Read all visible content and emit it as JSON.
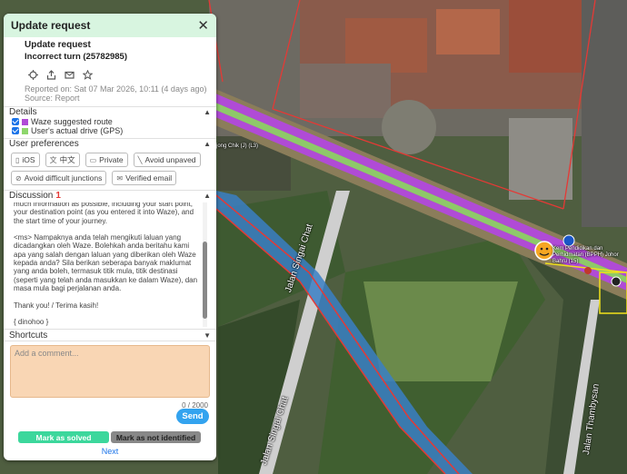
{
  "panel": {
    "title": "Update request",
    "close_glyph": "✕"
  },
  "request": {
    "title": "Update request",
    "type": "Incorrect turn (25782985)",
    "reported": "Reported on: Sat 07 Mar 2026, 10:11 (4 days ago)",
    "source": "Source: Report"
  },
  "details": {
    "header": "Details",
    "items": [
      {
        "label": "Waze suggested route",
        "color": "#b04bd6"
      },
      {
        "label": "User's actual drive (GPS)",
        "color": "#8ed66c"
      }
    ]
  },
  "preferences": {
    "header": "User preferences",
    "items": [
      {
        "label": "iOS",
        "icon": "phone-icon",
        "glyph": "▯"
      },
      {
        "label": "中文",
        "icon": "translate-icon",
        "glyph": "文"
      },
      {
        "label": "Private",
        "icon": "car-icon",
        "glyph": "▭"
      },
      {
        "label": "Avoid unpaved",
        "icon": "unpaved-icon",
        "glyph": "╲"
      },
      {
        "label": "Avoid difficult junctions",
        "icon": "junction-icon",
        "glyph": "⊘"
      },
      {
        "label": "Verified email",
        "icon": "email-icon",
        "glyph": "✉"
      }
    ]
  },
  "discussion": {
    "header": "Discussion",
    "count": "1",
    "text": "much information as possible, including your start point, your destination point (as you entered it into Waze), and the start time of your journey.\n\n<ms> Nampaknya anda telah mengikuti laluan yang dicadangkan oleh Waze. Bolehkah anda beritahu kami apa yang salah dengan laluan yang diberikan oleh Waze kepada anda? Sila berikan seberapa banyak maklumat yang anda boleh, termasuk titik mula, titik destinasi (seperti yang telah anda masukkan ke dalam Waze), dan masa mula bagi perjalanan anda.\n\nThank you! / Terima kasih!\n\n{ dinohoo }\nVolunteer, Map Editor Community\nSukarelawan, Komuniti Penyunting Peta\nWAZE MALAYSIA"
  },
  "shortcuts": {
    "header": "Shortcuts"
  },
  "comment": {
    "placeholder": "Add a comment...",
    "counter": "0 / 2000",
    "send_label": "Send"
  },
  "actions": {
    "solved_label": "Mark as solved",
    "not_identified_label": "Mark as not identified",
    "next_label": "Next"
  },
  "map": {
    "labels": {
      "street_1": "Jalan Singai Chat",
      "street_2": "Jalan Singai Chat",
      "street_3": "Jalan Thambysan",
      "poi_1": "Kem Pendidikan dan Perhidmatan (BPPH) Johor Bahru (15)",
      "poi_2": "jong Chik (J) (L3)"
    },
    "colors": {
      "waze_route": "#b04bd6",
      "gps_drive": "#8ed66c",
      "boundary": "#e53935",
      "river": "#3a7fc4",
      "marker": "#f5a623"
    }
  }
}
